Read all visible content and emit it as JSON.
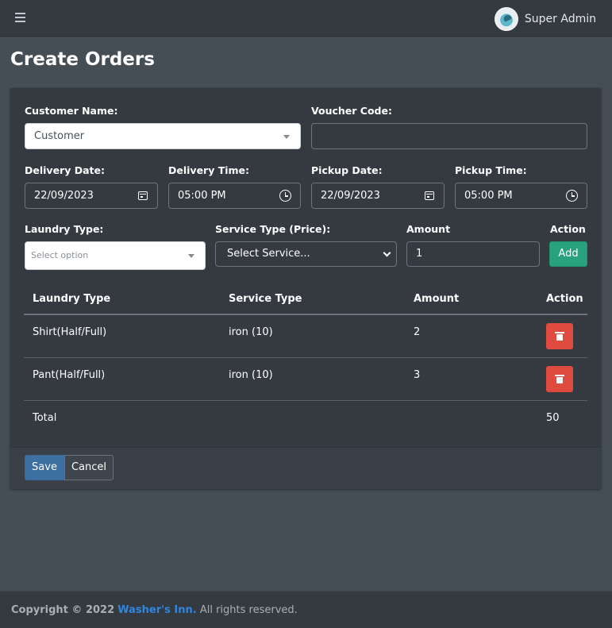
{
  "navbar": {
    "user_name": "Super Admin"
  },
  "page": {
    "title": "Create Orders"
  },
  "form": {
    "customer_name_label": "Customer Name:",
    "customer_value": "Customer",
    "voucher_label": "Voucher Code:",
    "voucher_value": "",
    "delivery_date_label": "Delivery Date:",
    "delivery_date_value": "22/09/2023",
    "delivery_time_label": "Delivery Time:",
    "delivery_time_value": "05:00 PM",
    "pickup_date_label": "Pickup Date:",
    "pickup_date_value": "22/09/2023",
    "pickup_time_label": "Pickup Time:",
    "pickup_time_value": "05:00 PM",
    "laundry_type_label": "Laundry Type:",
    "laundry_type_placeholder": "Select option",
    "service_type_label": "Service Type (Price):",
    "service_type_value": "Select Service...",
    "amount_label": "Amount",
    "amount_value": "1",
    "action_label": "Action",
    "add_label": "Add"
  },
  "table": {
    "headers": [
      "Laundry Type",
      "Service Type",
      "Amount",
      "Action"
    ],
    "rows": [
      {
        "laundry_type": "Shirt(Half/Full)",
        "service_type": "iron (10)",
        "amount": "2"
      },
      {
        "laundry_type": "Pant(Half/Full)",
        "service_type": "iron (10)",
        "amount": "3"
      }
    ],
    "total_label": "Total",
    "total_value": "50"
  },
  "actions": {
    "save_label": "Save",
    "cancel_label": "Cancel"
  },
  "footer": {
    "copyright": "Copyright © 2022",
    "brand": "Washer's Inn.",
    "rights": "All rights reserved."
  },
  "colors": {
    "add_button": "#28a27d",
    "delete_button": "#e04b3f",
    "save_button": "#3d6fa3",
    "brand_link": "#2f87e0"
  }
}
